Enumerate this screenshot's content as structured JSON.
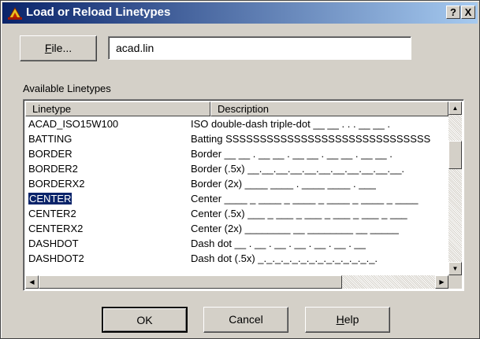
{
  "window": {
    "title": "Load or Reload Linetypes",
    "help_glyph": "?",
    "close_glyph": "X",
    "icon": "autocad-app-icon"
  },
  "file": {
    "button_label_underlined": "F",
    "button_label_rest": "ile...",
    "value": "acad.lin"
  },
  "list": {
    "label": "Available Linetypes",
    "columns": {
      "linetype": "Linetype",
      "description": "Description"
    },
    "rows": [
      {
        "name": "ACAD_ISO15W100",
        "description": "ISO double-dash triple-dot __ __ . . . __ __ ."
      },
      {
        "name": "BATTING",
        "description": "Batting SSSSSSSSSSSSSSSSSSSSSSSSSSSSSS"
      },
      {
        "name": "BORDER",
        "description": "Border __ __ . __ __ . __ __ . __ __ . __ __ ."
      },
      {
        "name": "BORDER2",
        "description": "Border (.5x) __.__.__.__.__.__.__.__.__.__.__."
      },
      {
        "name": "BORDERX2",
        "description": "Border (2x) ____ ____ . ____ ____ . ___"
      },
      {
        "name": "CENTER",
        "description": "Center ____ _ ____ _ ____ _ ____ _ ____ _ ____",
        "selected": true
      },
      {
        "name": "CENTER2",
        "description": "Center (.5x) ___ _ ___ _ ___ _ ___ _ ___ _ ___"
      },
      {
        "name": "CENTERX2",
        "description": "Center (2x) ________ __ ________ __ _____"
      },
      {
        "name": "DASHDOT",
        "description": "Dash dot __ . __ . __ . __ . __ . __ . __"
      },
      {
        "name": "DASHDOT2",
        "description": "Dash dot (.5x) _._._._._._._._._._._._._._."
      }
    ]
  },
  "buttons": {
    "ok": "OK",
    "cancel": "Cancel",
    "help_underlined": "H",
    "help_rest": "elp"
  },
  "icons": {
    "scroll_up": "arrow-up-icon",
    "scroll_down": "arrow-down-icon",
    "scroll_left": "arrow-left-icon",
    "scroll_right": "arrow-right-icon"
  },
  "colors": {
    "title_start": "#0a246a",
    "title_end": "#a6caf0",
    "selection": "#0a246a",
    "face": "#d4d0c8"
  }
}
